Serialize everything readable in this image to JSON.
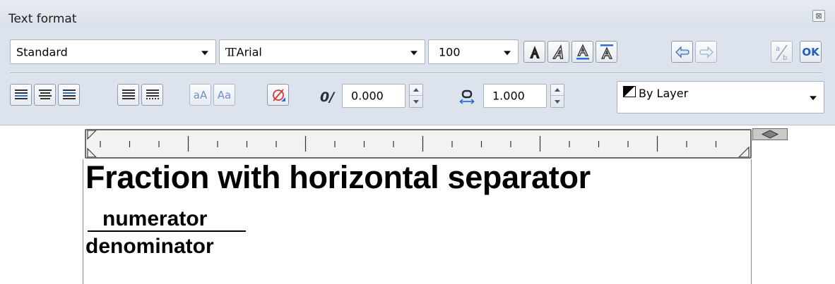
{
  "window": {
    "title": "Text format",
    "close_glyph": "⊠"
  },
  "row1": {
    "style": "Standard",
    "font": "Arial",
    "font_icon": "truetype-font-icon",
    "size": "100",
    "ok_label": "OK",
    "buttons": [
      "bold-button",
      "italic-button",
      "underline-button",
      "overline-button",
      "undo-button",
      "redo-button",
      "stack-fraction-button",
      "ok-button"
    ]
  },
  "row2": {
    "align_buttons": [
      "align-left-button",
      "align-center-button",
      "align-right-button",
      "justify-button",
      "distribute-button"
    ],
    "lowercase_label": "aA",
    "uppercase_label": "Aa",
    "oblique_glyph": "0/",
    "oblique_value": "0.000",
    "tracking_value": "1.000",
    "color": "By Layer"
  },
  "colors": {
    "panel": "#dde3ec",
    "accent_blue": "#2b6fd6",
    "disabled": "#9aa7b8"
  },
  "editor": {
    "heading": "Fraction with horizontal separator",
    "numerator": "numerator",
    "denominator": "denominator"
  }
}
